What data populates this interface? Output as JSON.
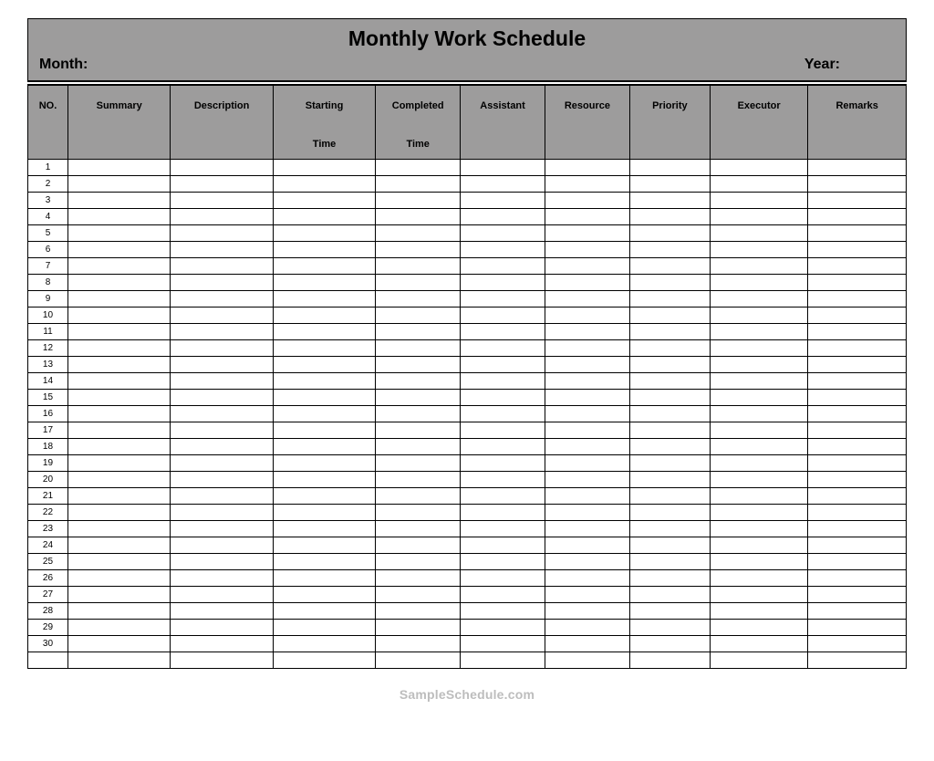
{
  "header": {
    "title": "Monthly Work Schedule",
    "month_label": "Month:",
    "year_label": "Year:"
  },
  "columns": [
    {
      "line1": "NO.",
      "line2": ""
    },
    {
      "line1": "Summary",
      "line2": ""
    },
    {
      "line1": "Description",
      "line2": ""
    },
    {
      "line1": "Starting",
      "line2": "Time"
    },
    {
      "line1": "Completed",
      "line2": "Time"
    },
    {
      "line1": "Assistant",
      "line2": ""
    },
    {
      "line1": "Resource",
      "line2": ""
    },
    {
      "line1": "Priority",
      "line2": ""
    },
    {
      "line1": "Executor",
      "line2": ""
    },
    {
      "line1": "Remarks",
      "line2": ""
    }
  ],
  "rows": [
    {
      "no": "1"
    },
    {
      "no": "2"
    },
    {
      "no": "3"
    },
    {
      "no": "4"
    },
    {
      "no": "5"
    },
    {
      "no": "6"
    },
    {
      "no": "7"
    },
    {
      "no": "8"
    },
    {
      "no": "9"
    },
    {
      "no": "10"
    },
    {
      "no": "11"
    },
    {
      "no": "12"
    },
    {
      "no": "13"
    },
    {
      "no": "14"
    },
    {
      "no": "15"
    },
    {
      "no": "16"
    },
    {
      "no": "17"
    },
    {
      "no": "18"
    },
    {
      "no": "19"
    },
    {
      "no": "20"
    },
    {
      "no": "21"
    },
    {
      "no": "22"
    },
    {
      "no": "23"
    },
    {
      "no": "24"
    },
    {
      "no": "25"
    },
    {
      "no": "26"
    },
    {
      "no": "27"
    },
    {
      "no": "28"
    },
    {
      "no": "29"
    },
    {
      "no": "30"
    }
  ],
  "watermark": "SampleSchedule.com"
}
